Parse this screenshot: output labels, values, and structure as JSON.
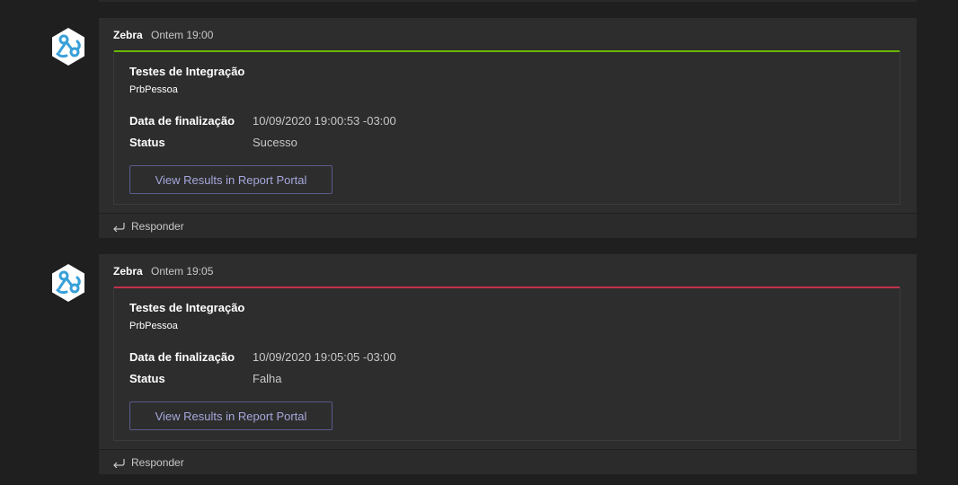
{
  "messages": [
    {
      "sender": "Zebra",
      "timestamp": "Ontem 19:00",
      "card": {
        "accent_color": "#6bb700",
        "title": "Testes de Integração",
        "subtitle": "PrbPessoa",
        "facts": [
          {
            "key": "Data de finalização",
            "value": "10/09/2020 19:00:53 -03:00"
          },
          {
            "key": "Status",
            "value": "Sucesso"
          }
        ],
        "button_label": "View Results in Report Portal"
      },
      "reply_label": "Responder"
    },
    {
      "sender": "Zebra",
      "timestamp": "Ontem 19:05",
      "card": {
        "accent_color": "#c4314b",
        "title": "Testes de Integração",
        "subtitle": "PrbPessoa",
        "facts": [
          {
            "key": "Data de finalização",
            "value": "10/09/2020 19:05:05 -03:00"
          },
          {
            "key": "Status",
            "value": "Falha"
          }
        ],
        "button_label": "View Results in Report Portal"
      },
      "reply_label": "Responder"
    }
  ],
  "avatar_icon": "zebra-bot-hexagon-icon",
  "reply_icon": "reply-arrow-icon"
}
